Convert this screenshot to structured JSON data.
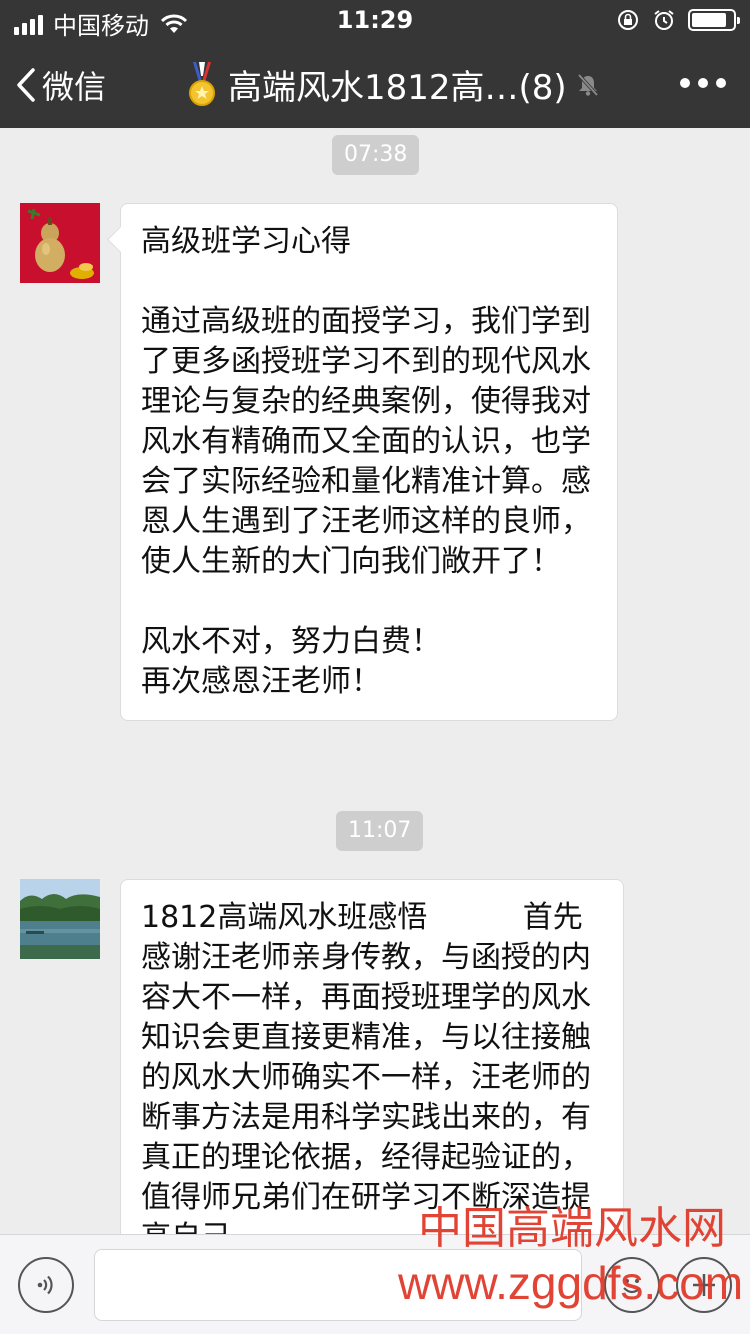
{
  "status_bar": {
    "carrier": "中国移动",
    "time": "11:29",
    "battery_level": 0.85
  },
  "nav": {
    "back_label": "微信",
    "title": "高端风水1812高…(8)"
  },
  "messages": [
    {
      "timestamp": "07:38",
      "text": "高级班学习心得\n\n通过高级班的面授学习，我们学到了更多函授班学习不到的现代风水理论与复杂的经典案例，使得我对风水有精确而又全面的认识，也学会了实际经验和量化精准计算。感恩人生遇到了汪老师这样的良师，使人生新的大门向我们敞开了！\n\n风水不对，努力白费！\n再次感恩汪老师！"
    },
    {
      "timestamp": "11:07",
      "text": "1812高端风水班感悟          首先感谢汪老师亲身传教，与函授的内容大不一样，再面授班理学的风水知识会更直接更精准，与以往接触的风水大师确实不一样，汪老师的断事方法是用科学实践出来的，有真正的理论依据，经得起验证的，值得师兄弟们在研学习不断深造提高自己"
    }
  ],
  "watermark": {
    "line1": "中国高端风水网",
    "line2": "www.zggdfs.com"
  },
  "colors": {
    "header_bg": "#363636",
    "chat_bg": "#ededed",
    "watermark": "#e03a2a"
  }
}
